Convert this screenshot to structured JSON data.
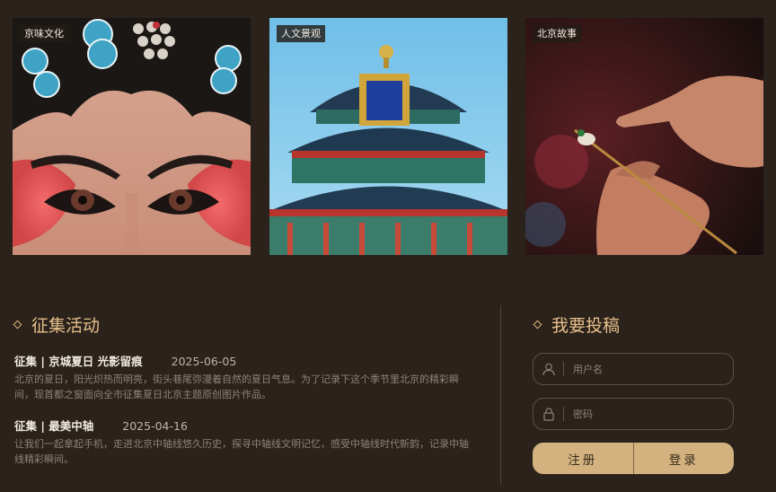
{
  "photos": [
    {
      "tag": "京味文化"
    },
    {
      "tag": "人文景观"
    },
    {
      "tag": "北京故事"
    }
  ],
  "campaigns": {
    "title": "征集活动",
    "items": [
      {
        "title": "征集 | 京城夏日 光影留痕",
        "date": "2025-06-05",
        "desc": "北京的夏日，阳光炽热而明亮，街头巷尾弥漫着自然的夏日气息。为了记录下这个季节里北京的精彩瞬间，现首都之窗面向全市征集夏日北京主题原创图片作品。"
      },
      {
        "title": "征集 | 最美中轴",
        "date": "2025-04-16",
        "desc": "让我们一起拿起手机，走进北京中轴线悠久历史，探寻中轴线文明记忆，感受中轴线时代新韵，记录中轴线精彩瞬间。"
      }
    ]
  },
  "submit": {
    "title": "我要投稿",
    "username_placeholder": "用户名",
    "password_placeholder": "密码",
    "register_label": "注册",
    "login_label": "登录"
  },
  "colors": {
    "background": "#2b221b",
    "accent": "#e6c08b",
    "button": "#d3b27f"
  }
}
